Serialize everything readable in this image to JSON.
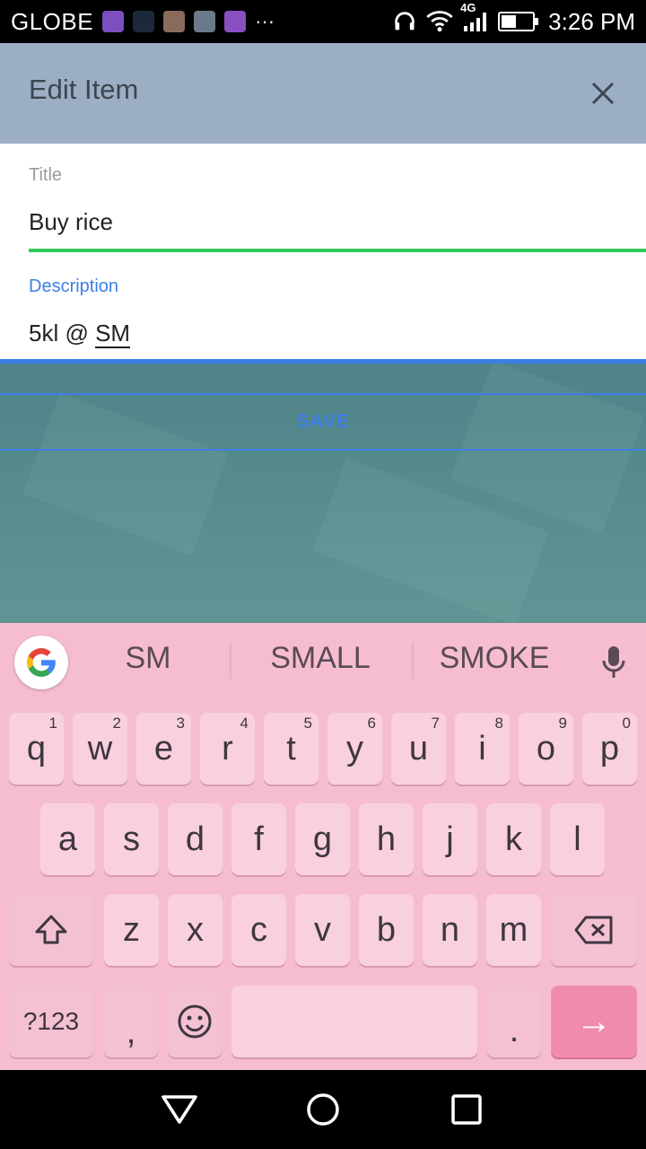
{
  "status_bar": {
    "carrier": "GLOBE",
    "more": "···",
    "network": "4G",
    "time": "3:26 PM"
  },
  "app_bar": {
    "title": "Edit Item"
  },
  "form": {
    "title_label": "Title",
    "title_value": "Buy rice",
    "description_label": "Description",
    "description_value_prefix": "5kl @ ",
    "description_value_composing": "SM"
  },
  "save_label": "SAVE",
  "keyboard": {
    "suggestions": [
      "SM",
      "SMALL",
      "SMOKE"
    ],
    "row1": [
      "q",
      "w",
      "e",
      "r",
      "t",
      "y",
      "u",
      "i",
      "o",
      "p"
    ],
    "row1_hints": [
      "1",
      "2",
      "3",
      "4",
      "5",
      "6",
      "7",
      "8",
      "9",
      "0"
    ],
    "row2": [
      "a",
      "s",
      "d",
      "f",
      "g",
      "h",
      "j",
      "k",
      "l"
    ],
    "row3": [
      "z",
      "x",
      "c",
      "v",
      "b",
      "n",
      "m"
    ],
    "symbols_label": "?123",
    "comma": ",",
    "period": ".",
    "enter_glyph": "→"
  },
  "colors": {
    "app_bar_bg": "#9caec3",
    "title_underline": "#2ecc55",
    "accent_blue": "#3d7ee6",
    "keyboard_bg": "#f6bdd0"
  }
}
